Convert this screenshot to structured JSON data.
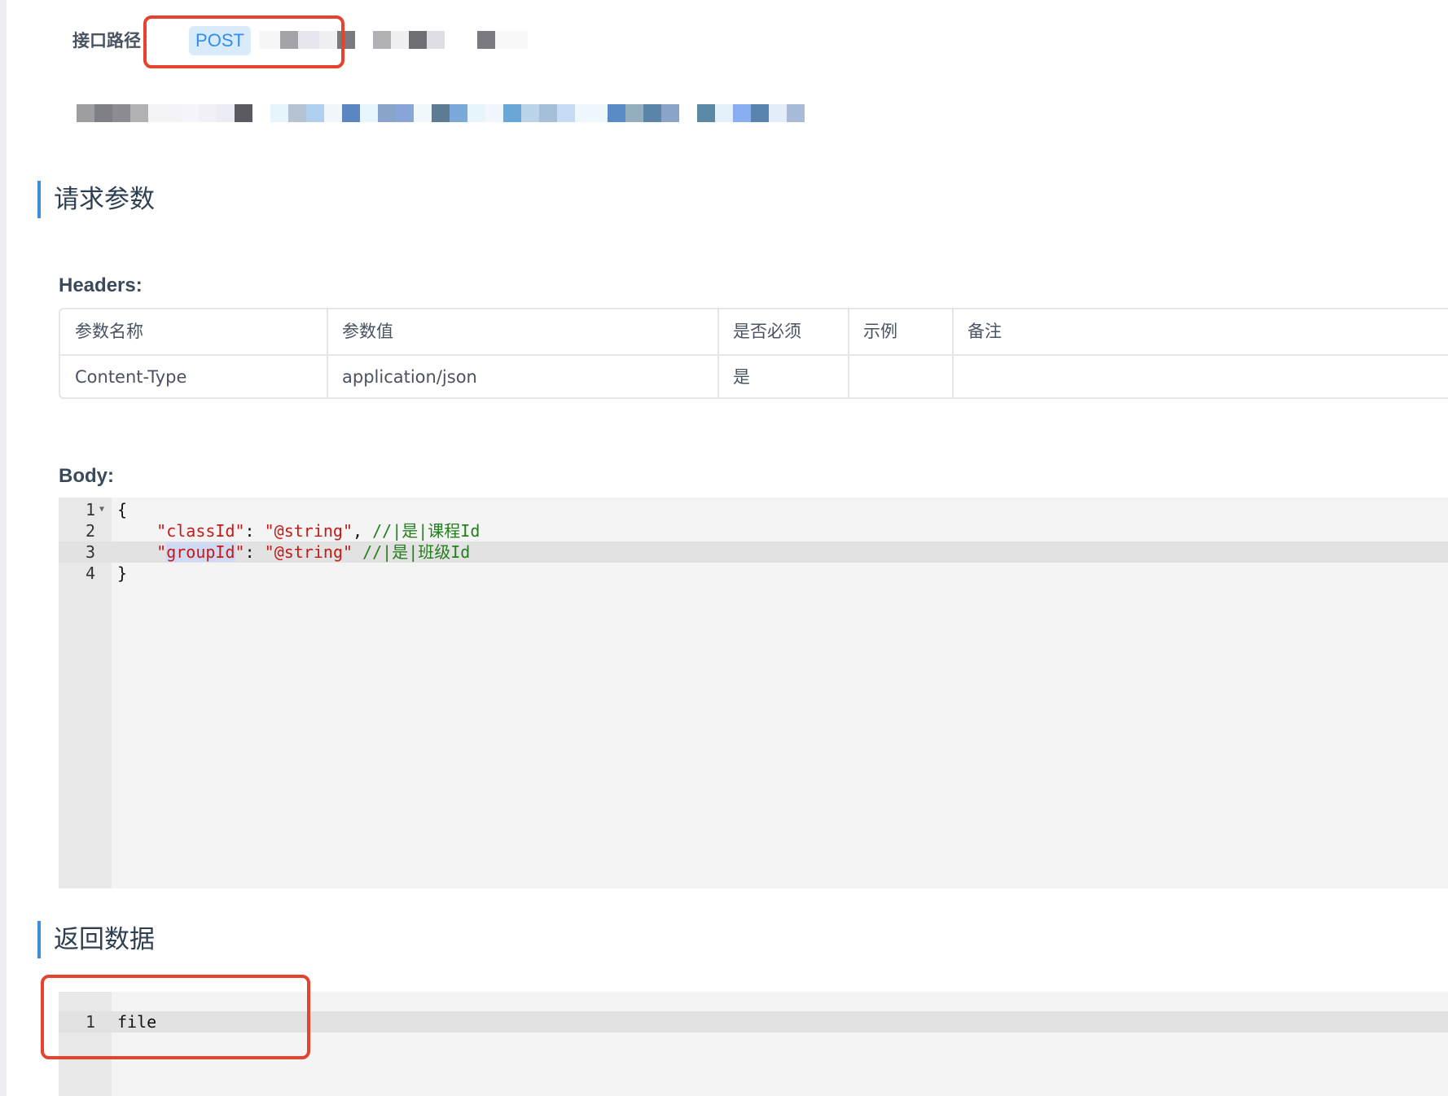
{
  "api_path": {
    "label": "接口路径：",
    "method": "POST"
  },
  "request_section": {
    "title": "请求参数"
  },
  "headers": {
    "title": "Headers:",
    "columns": [
      "参数名称",
      "参数值",
      "是否必须",
      "示例",
      "备注"
    ],
    "rows": [
      [
        "Content-Type",
        "application/json",
        "是",
        "",
        ""
      ]
    ]
  },
  "body": {
    "title": "Body:",
    "lines": [
      {
        "num": "1",
        "brace": "{"
      },
      {
        "num": "2",
        "key": "\"classId\"",
        "colon": ": ",
        "value": "\"@string\"",
        "sep": ", ",
        "comment": "//|是|课程Id"
      },
      {
        "num": "3",
        "key_q1": "\"",
        "key_name": "groupId",
        "key_q2": "\"",
        "colon": ": ",
        "value": "\"@string\"",
        "sep": " ",
        "comment": "//|是|班级Id"
      },
      {
        "num": "4",
        "brace": "}"
      }
    ]
  },
  "response_section": {
    "title": "返回数据"
  },
  "response": {
    "lines": [
      {
        "num": "1",
        "text": "file"
      }
    ]
  },
  "colors": {
    "accent": "#3d8ee0",
    "highlight": "#e6432e",
    "method_text": "#2f8ef0"
  }
}
